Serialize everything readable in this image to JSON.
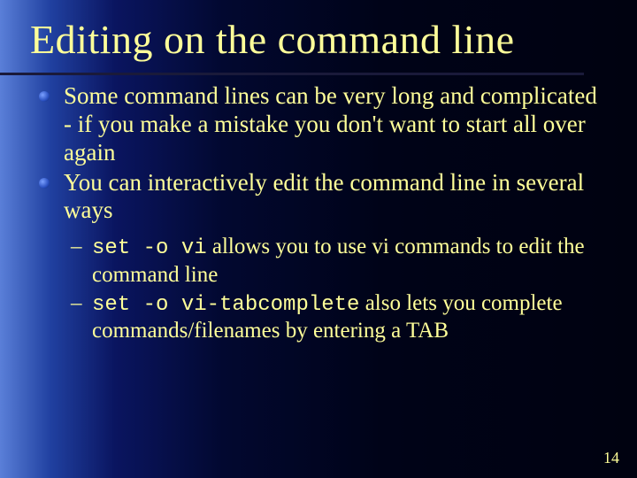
{
  "title": "Editing on the command line",
  "bullets": [
    "Some command lines can be very long and complicated - if you make a mistake you don't want to start all over again",
    "You can interactively edit the command line in several ways"
  ],
  "subs": [
    {
      "code": "set -o vi",
      "rest": " allows you to use vi commands to edit the command line"
    },
    {
      "code": "set -o vi-tabcomplete",
      "rest": " also lets you complete commands/filenames by entering a TAB"
    }
  ],
  "page_number": "14"
}
